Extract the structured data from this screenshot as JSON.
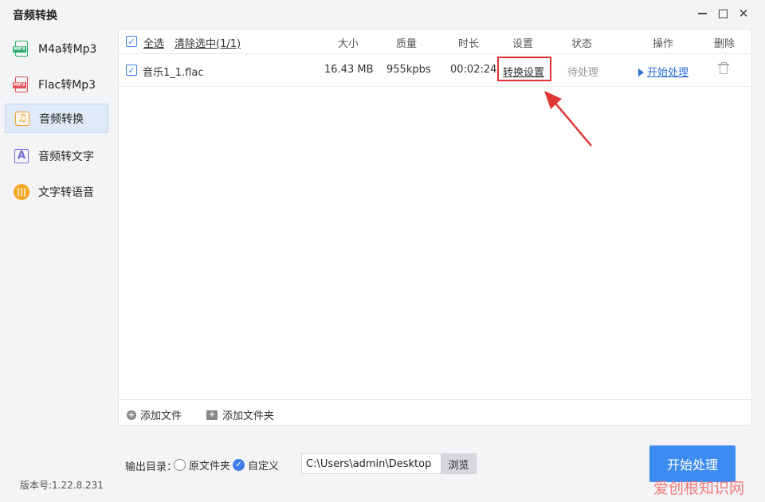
{
  "window": {
    "title": "音频转换"
  },
  "sidebar": {
    "items": [
      {
        "label": "M4a转Mp3",
        "icon": "m4a-file-icon",
        "icon_tag": "MP3"
      },
      {
        "label": "Flac转Mp3",
        "icon": "flac-file-icon",
        "icon_tag": "MP3"
      },
      {
        "label": "音频转换",
        "icon": "music-note-icon"
      },
      {
        "label": "音频转文字",
        "icon": "audio-to-text-icon",
        "icon_tag": "A"
      },
      {
        "label": "文字转语音",
        "icon": "text-to-speech-icon"
      }
    ],
    "active_index": 2
  },
  "version": "版本号:1.22.8.231",
  "table": {
    "select_all": "全选",
    "clear_selection": "清除选中(1/1)",
    "headers": {
      "size": "大小",
      "quality": "质量",
      "duration": "时长",
      "settings": "设置",
      "status": "状态",
      "action": "操作",
      "delete": "删除"
    },
    "rows": [
      {
        "checked": true,
        "name": "音乐1_1.flac",
        "size": "16.43 MB",
        "quality": "955kpbs",
        "duration": "00:02:24",
        "settings": "转换设置",
        "status": "待处理",
        "action": "开始处理"
      }
    ]
  },
  "footer": {
    "add_file": "添加文件",
    "add_folder": "添加文件夹"
  },
  "output": {
    "label": "输出目录：",
    "options": [
      "原文件夹",
      "自定义"
    ],
    "selected": "自定义",
    "path": "C:\\Users\\admin\\Desktop",
    "browse": "浏览"
  },
  "start_button": "开始处理",
  "watermark": "爱创根知识网",
  "colors": {
    "accent": "#3d8bf0",
    "highlight": "#e03030",
    "link": "#2b6fd6"
  }
}
